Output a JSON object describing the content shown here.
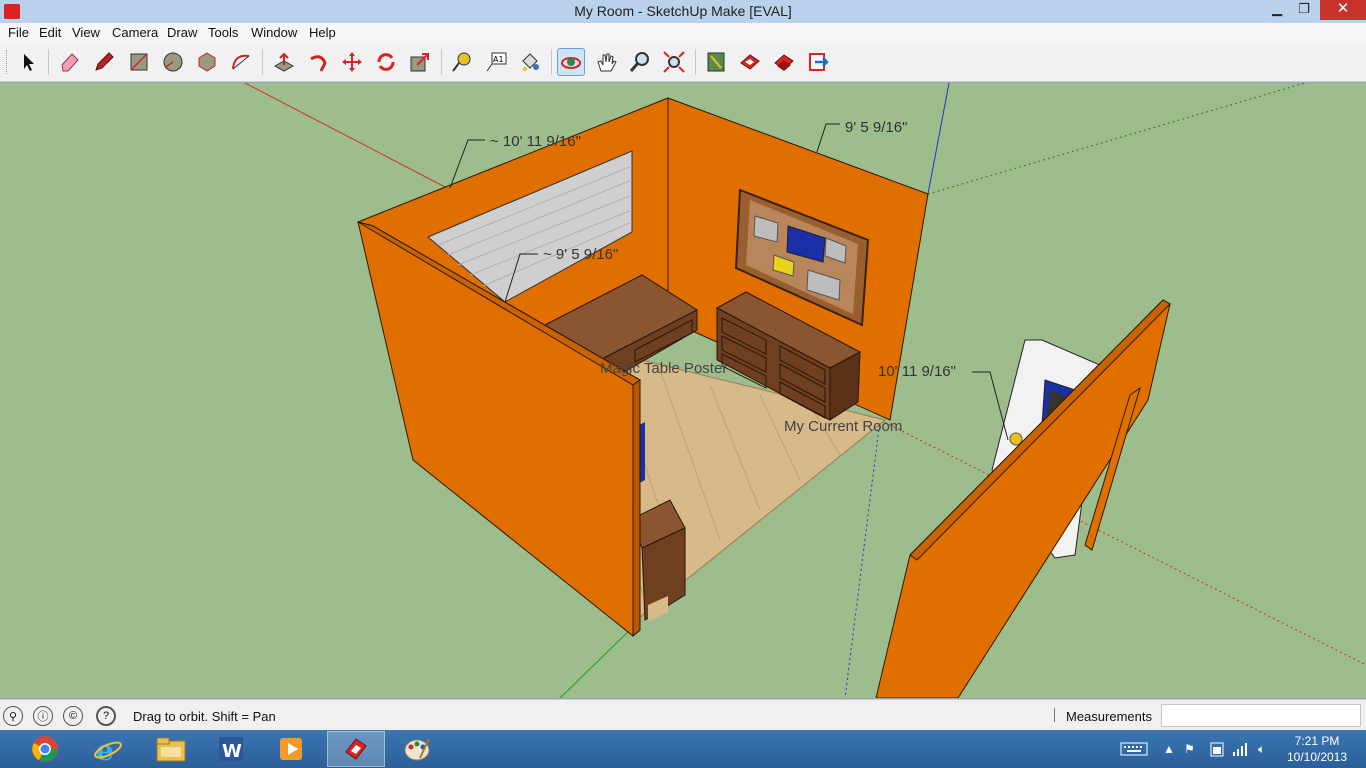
{
  "window": {
    "title": "My Room - SketchUp Make [EVAL]",
    "minimize_glyph": "▁",
    "restore_glyph": "❐",
    "close_glyph": "✕"
  },
  "menu": [
    "File",
    "Edit",
    "View",
    "Camera",
    "Draw",
    "Tools",
    "Window",
    "Help"
  ],
  "toolbar": {
    "tools": [
      "select-tool",
      "eraser-tool",
      "pencil-tool",
      "rectangle-tool",
      "circle-tool",
      "polygon-tool",
      "arc-tool",
      "push-pull-tool",
      "follow-me-tool",
      "move-tool",
      "rotate-tool",
      "scale-tool",
      "tape-measure-tool",
      "text-tool",
      "paint-bucket-tool",
      "orbit-tool",
      "pan-tool",
      "zoom-tool",
      "zoom-extents-tool",
      "component-browser-tool",
      "3d-warehouse-tool",
      "share-model-tool",
      "upload-tool"
    ],
    "active_tool": "orbit-tool",
    "text_tool_label": "A1"
  },
  "viewport": {
    "dimensions": [
      "~ 10' 11 9/16\"",
      "9' 5 9/16\"",
      "~ 9' 5 9/16\"",
      "10' 11 9/16\""
    ],
    "labels": [
      "Magic Table Poster",
      "My Current Room"
    ],
    "colors": {
      "ground": "#9ebd8c",
      "walls": "#e06f00",
      "wall_dark": "#b75800",
      "floor": "#d8b98a",
      "wood": "#7b4a2a"
    }
  },
  "statusbar": {
    "status_text": "Drag to orbit.  Shift = Pan",
    "measurements_label": "Measurements",
    "measurements_value": "",
    "help_glyph": "?"
  },
  "taskbar": {
    "apps": [
      "chrome",
      "internet-explorer",
      "file-explorer",
      "word",
      "media-player",
      "sketchup",
      "paint"
    ],
    "active_app": "sketchup",
    "word_letter": "W",
    "clock_time": "7:21 PM",
    "clock_date": "10/10/2013",
    "tray_expand_glyph": "▲"
  }
}
